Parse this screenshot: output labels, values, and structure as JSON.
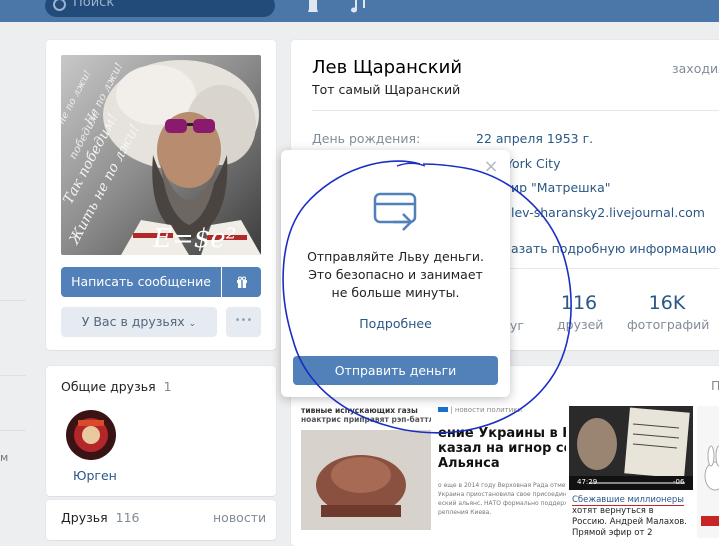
{
  "header": {
    "search_placeholder": "Поиск"
  },
  "left_strip": {
    "text": "м"
  },
  "profile": {
    "name": "Лев Щаранский",
    "status": "Тот самый Щаранский",
    "online": "заходил",
    "birthday_label": "День рождения:",
    "birthday_value": "22 апреля 1953 г.",
    "city_value": "York City",
    "work_value": "ир \"Матрешка\"",
    "site_value": "lev-sharansky2.livejournal.com",
    "more_info": "азать подробную информацию",
    "counters": [
      {
        "value": "116",
        "label": "друзей"
      },
      {
        "value": "16K",
        "label": "фотографий"
      }
    ],
    "partial_counter_label": "руг"
  },
  "avatar": {
    "overlay_formula": "E=$e²",
    "side_texts": [
      "Так победим!",
      "Жить не по лжи!",
      "Не по лжи!",
      "победим!",
      "не по лжи!"
    ]
  },
  "actions": {
    "message_button": "Написать сообщение",
    "friends_button": "У Вас в друзьях",
    "more_button": "•••"
  },
  "common_friends": {
    "title": "Общие друзья",
    "count": "1",
    "friend_name": "Юрген"
  },
  "friends": {
    "title": "Друзья",
    "count": "116",
    "updates": "новости"
  },
  "popup": {
    "text": "Отправляйте Льву деньги. Это безопасно и занимает не больше минуты.",
    "more_link": "Подробнее",
    "send_button": "Отправить деньги"
  },
  "news": {
    "corner": "П",
    "tag": "новости политики",
    "headline1_top": "тивные испускающих газы",
    "headline1_sub": "ноактрис приправят рэп-баттл",
    "headline2": "ение Украины в НА\nказал на игнор со\nАльянса",
    "small_text": "о еще в 2014 году Верховная Рада отмени\nУкраина приостановила свое присоедин\nеский альянс, НАТО формально поддерж\nрепления Киева.",
    "video_time": "47:29",
    "video_remaining": "-06",
    "video_caption_highlight": "Сбежавшие миллионеры",
    "video_caption_rest": " хотят вернуться в Россию. Андрей Малахов. Прямой эфир от 2"
  },
  "colors": {
    "topbar": "#4a76a8",
    "button_primary": "#5181b8",
    "link": "#2a5885",
    "pen": "#1a2ec4"
  }
}
